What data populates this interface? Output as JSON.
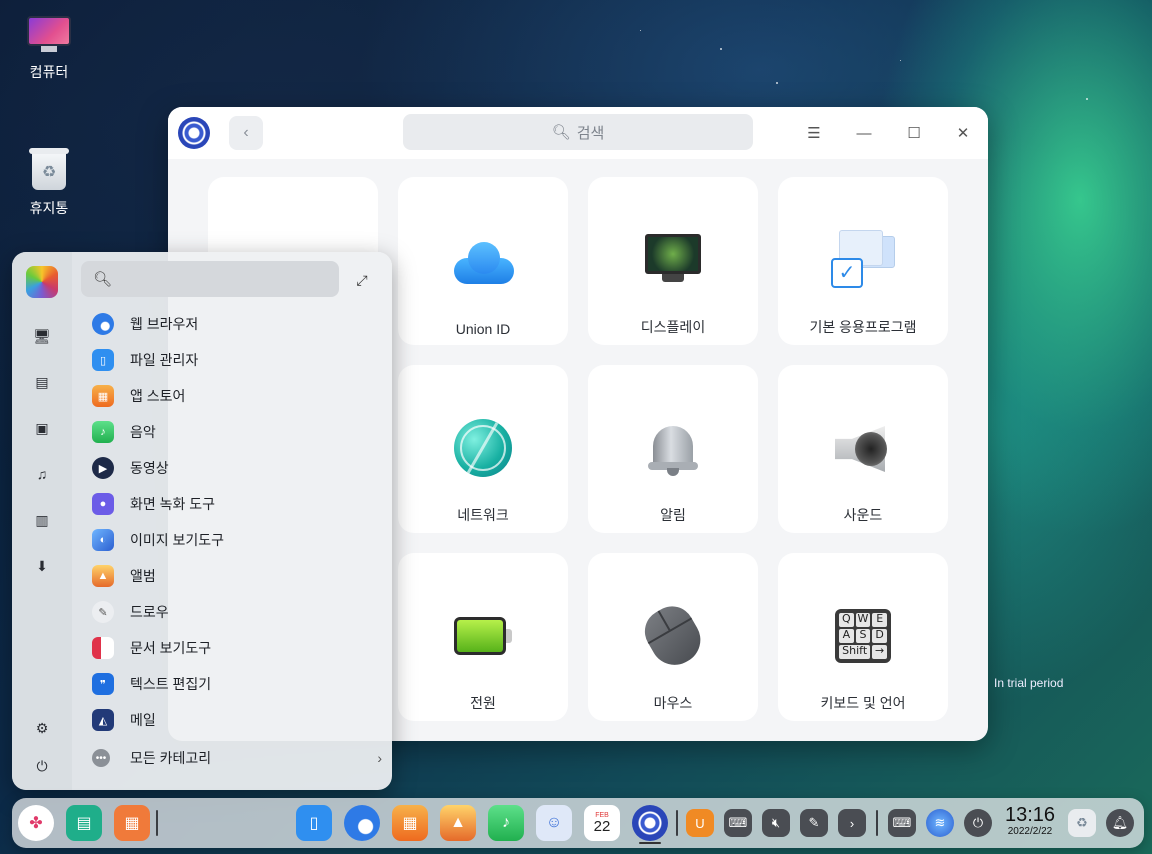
{
  "desktop": {
    "icons": [
      {
        "label": "컴퓨터"
      },
      {
        "label": "휴지통"
      }
    ],
    "trial_text": "In trial period"
  },
  "settings": {
    "search_placeholder": "검색",
    "modules": [
      {
        "label": "",
        "icon": "account-icon"
      },
      {
        "label": "Union ID",
        "icon": "cloud-icon"
      },
      {
        "label": "디스플레이",
        "icon": "display-icon"
      },
      {
        "label": "기본 응용프로그램",
        "icon": "default-apps-icon"
      },
      {
        "label": "네트워크",
        "icon": "network-globe-icon"
      },
      {
        "label": "알림",
        "icon": "bell-icon"
      },
      {
        "label": "사운드",
        "icon": "speaker-icon"
      },
      {
        "label": "전원",
        "icon": "battery-icon"
      },
      {
        "label": "마우스",
        "icon": "mouse-icon"
      },
      {
        "label": "키보드 및 언어",
        "icon": "keyboard-icon"
      }
    ],
    "keyboard_keys": [
      "Q",
      "W",
      "E",
      "A",
      "S",
      "D",
      "Shift",
      "→"
    ]
  },
  "launcher": {
    "apps": [
      {
        "label": "웹 브라우저",
        "icon": "browser-icon",
        "color": "#2e7ae6"
      },
      {
        "label": "파일 관리자",
        "icon": "file-manager-icon",
        "color": "#2f8ff0"
      },
      {
        "label": "앱 스토어",
        "icon": "app-store-icon",
        "color": "#f08a24"
      },
      {
        "label": "음악",
        "icon": "music-icon",
        "color": "#34c759"
      },
      {
        "label": "동영상",
        "icon": "video-icon",
        "color": "#1e2a48"
      },
      {
        "label": "화면 녹화 도구",
        "icon": "screen-recorder-icon",
        "color": "#6c5ce7"
      },
      {
        "label": "이미지 보기도구",
        "icon": "image-viewer-icon",
        "color": "#3a6fd8"
      },
      {
        "label": "앨범",
        "icon": "album-icon",
        "color": "#f0a030"
      },
      {
        "label": "드로우",
        "icon": "draw-icon",
        "color": "#d0d4da"
      },
      {
        "label": "문서 보기도구",
        "icon": "document-viewer-icon",
        "color": "#e0324a"
      },
      {
        "label": "텍스트 편집기",
        "icon": "text-editor-icon",
        "color": "#1f6fe0"
      },
      {
        "label": "메일",
        "icon": "mail-icon",
        "color": "#223a78"
      }
    ],
    "all_categories": "모든 카테고리"
  },
  "dock": {
    "time": "13:16",
    "date": "2022/2/22",
    "calendar_month": "FEB",
    "calendar_day": "22"
  }
}
